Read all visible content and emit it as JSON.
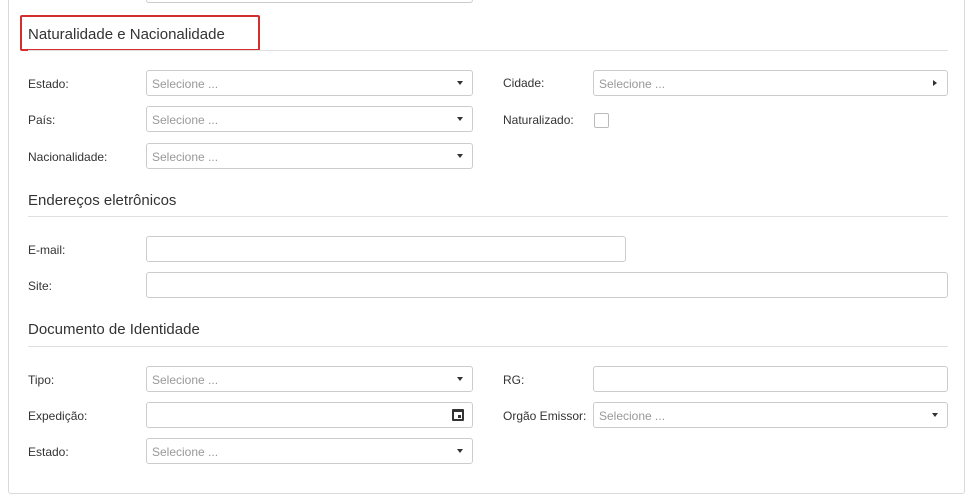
{
  "sections": {
    "naturalidade": {
      "title": "Naturalidade e Nacionalidade",
      "estado_label": "Estado:",
      "estado_placeholder": "Selecione ...",
      "cidade_label": "Cidade:",
      "cidade_placeholder": "Selecione ...",
      "pais_label": "País:",
      "pais_placeholder": "Selecione ...",
      "naturalizado_label": "Naturalizado:",
      "nacionalidade_label": "Nacionalidade:",
      "nacionalidade_placeholder": "Selecione ..."
    },
    "enderecos": {
      "title": "Endereços eletrônicos",
      "email_label": "E-mail:",
      "site_label": "Site:"
    },
    "documento": {
      "title": "Documento de Identidade",
      "tipo_label": "Tipo:",
      "tipo_placeholder": "Selecione ...",
      "rg_label": "RG:",
      "expedicao_label": "Expedição:",
      "orgao_label": "Orgão Emissor:",
      "orgao_placeholder": "Selecione ...",
      "estado_label": "Estado:",
      "estado_placeholder": "Selecione ..."
    }
  },
  "highlight_color": "#d32f2f",
  "icons": {
    "select_caret": "caret-down-icon",
    "cidade_caret": "caret-right-icon",
    "date_picker": "calendar-icon"
  }
}
